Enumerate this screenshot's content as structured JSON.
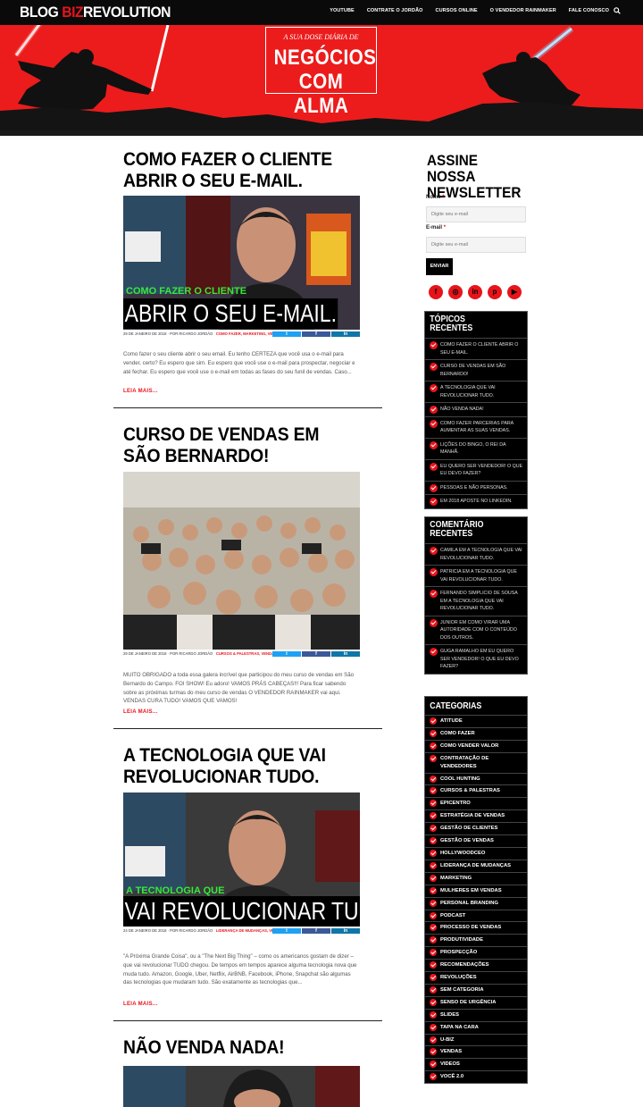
{
  "header": {
    "logo_blog": "BLOG",
    "logo_biz": "BIZ",
    "logo_revolution": "REVOLUTION",
    "nav": [
      "YOUTUBE",
      "CONTRATE O JORDÃO",
      "CURSOS ONLINE",
      "O VENDEDOR RAINMAKER",
      "FALE CONOSCO"
    ]
  },
  "hero": {
    "tagline": "A SUA DOSE DIÁRIA DE",
    "title_line1": "NEGÓCIOS",
    "title_line2": "COM ALMA"
  },
  "posts": [
    {
      "title": "COMO FAZER O CLIENTE ABRIR O SEU E-MAIL.",
      "img_small": "COMO FAZER O CLIENTE",
      "img_big": "ABRIR O SEU E-MAIL.",
      "date": "29 DE JANEIRO DE 2018",
      "author": "POR RICARDO JORDÃO",
      "cats": "COMO FAZER, MARKETING, VENDAS",
      "excerpt": " Como fazer o seu cliente abrir o seu email. Eu tenho CERTEZA que você usa o e-mail para vender, certo? Eu espero que sim. Eu espero que você use o e-mail para prospectar, negociar e até fechar. Eu espero que você use o e-mail em todas as fases do seu funil de vendas. Caso...",
      "readmore": "LEIA MAIS..."
    },
    {
      "title": "CURSO DE VENDAS EM SÃO BERNARDO!",
      "date": "29 DE JANEIRO DE 2018",
      "author": "POR RICARDO JORDÃO",
      "cats": "CURSOS & PALESTRAS, VENDAS",
      "excerpt": "MUITO OBRIGADO a toda essa galera incrível que participou do meu curso de vendas em São Bernardo do Campo. FOI SHOW! Eu adoro! VAMOS PRÁS CABEÇAS!!! Para ficar sabendo sobre as próximas turmas do meu curso de vendas O VENDEDOR RAINMAKER vai aqui. VENDAS CURA TUDO! VAMOS QUE VAMOS!",
      "readmore": "LEIA MAIS..."
    },
    {
      "title": "A TECNOLOGIA QUE VAI REVOLUCIONAR TUDO.",
      "img_small": "A TECNOLOGIA QUE",
      "img_big": "VAI REVOLUCIONAR TUDO!",
      "date": "24 DE JANEIRO DE 2018",
      "author": "POR RICARDO JORDÃO",
      "cats": "LIDERANÇA DE MUDANÇAS, VENDAS, VIDEOS",
      "excerpt": " \"A Próxima Grande Coisa\", ou a \"The Next Big Thing\" – como os americanos gostam de dizer – que vai revolucionar TUDO chegou. De tempos em tempos aparece alguma tecnologia nova que muda tudo. Amazon, Google, Uber, Netflix, AirBNB, Facebook, iPhone, Snapchat são algumas das tecnologias que mudaram tudo. São exatamente as tecnologias que...",
      "readmore": "LEIA MAIS..."
    },
    {
      "title": "NÃO VENDA NADA!"
    }
  ],
  "share": {
    "tw": "t",
    "fb": "f",
    "li": "in"
  },
  "newsletter": {
    "title": "ASSINE NOSSA NEWSLETTER",
    "name_label": "Nome",
    "email_label": "E-mail",
    "required": "*",
    "name_placeholder": "Digite seu e-mail",
    "email_placeholder": "Digite seu e-mail",
    "button": "ENVIAR"
  },
  "social": [
    "f",
    "◎",
    "in",
    "p",
    "▶"
  ],
  "recent_topics": {
    "title": "TÓPICOS RECENTES",
    "items": [
      "COMO FAZER O CLIENTE ABRIR O SEU E-MAIL.",
      "CURSO DE VENDAS EM SÃO BERNARDO!",
      "A TECNOLOGIA QUE VAI REVOLUCIONAR TUDO.",
      "NÃO VENDA NADA!",
      "COMO FAZER PARCERIAS PARA AUMENTAR AS SUAS VENDAS.",
      "LIÇÕES DO BINGO, O REI DA MANHÃ.",
      "EU QUERO SER VENDEDOR! O QUE EU DEVO FAZER?",
      "PESSOAS E NÃO PERSONAS.",
      "EM 2018 APOSTE NO LINKEDIN."
    ]
  },
  "recent_comments": {
    "title": "COMENTÁRIO RECENTES",
    "items": [
      "CAMILA EM A TECNOLOGIA QUE VAI REVOLUCIONAR TUDO.",
      "PATRICIA EM A TECNOLOGIA QUE VAI REVOLUCIONAR TUDO.",
      "FERNANDO SIMPLICIO DE SOUSA EM A TECNOLOGIA QUE VAI REVOLUCIONAR TUDO.",
      "JUNIOR EM COMO VIRAR UMA AUTORIDADE COM O CONTEÚDO DOS OUTROS.",
      "GUGA RAMALHO EM EU QUERO SER VENDEDOR! O QUE EU DEVO FAZER?"
    ]
  },
  "categories": {
    "title": "CATEGORIAS",
    "items": [
      "ATITUDE",
      "COMO FAZER",
      "COMO VENDER VALOR",
      "CONTRATAÇÃO DE VENDEDORES",
      "COOL HUNTING",
      "CURSOS & PALESTRAS",
      "EPICENTRO",
      "ESTRATÉGIA DE VENDAS",
      "GESTÃO DE CLIENTES",
      "GESTÃO DE VENDAS",
      "HOLLYWOODCEO",
      "LIDERANÇA DE MUDANÇAS",
      "MARKETING",
      "MULHERES EM VENDAS",
      "PERSONAL BRANDING",
      "PODCAST",
      "PROCESSO DE VENDAS",
      "PRODUTIVIDADE",
      "PROSPECÇÃO",
      "RECOMENDAÇÕES",
      "REVOLUÇÕES",
      "SEM CATEGORIA",
      "SENSO DE URGÊNCIA",
      "SLIDES",
      "TAPA NA CARA",
      "U-BIZ",
      "VENDAS",
      "VIDEOS",
      "VOCÊ 2.0"
    ]
  }
}
